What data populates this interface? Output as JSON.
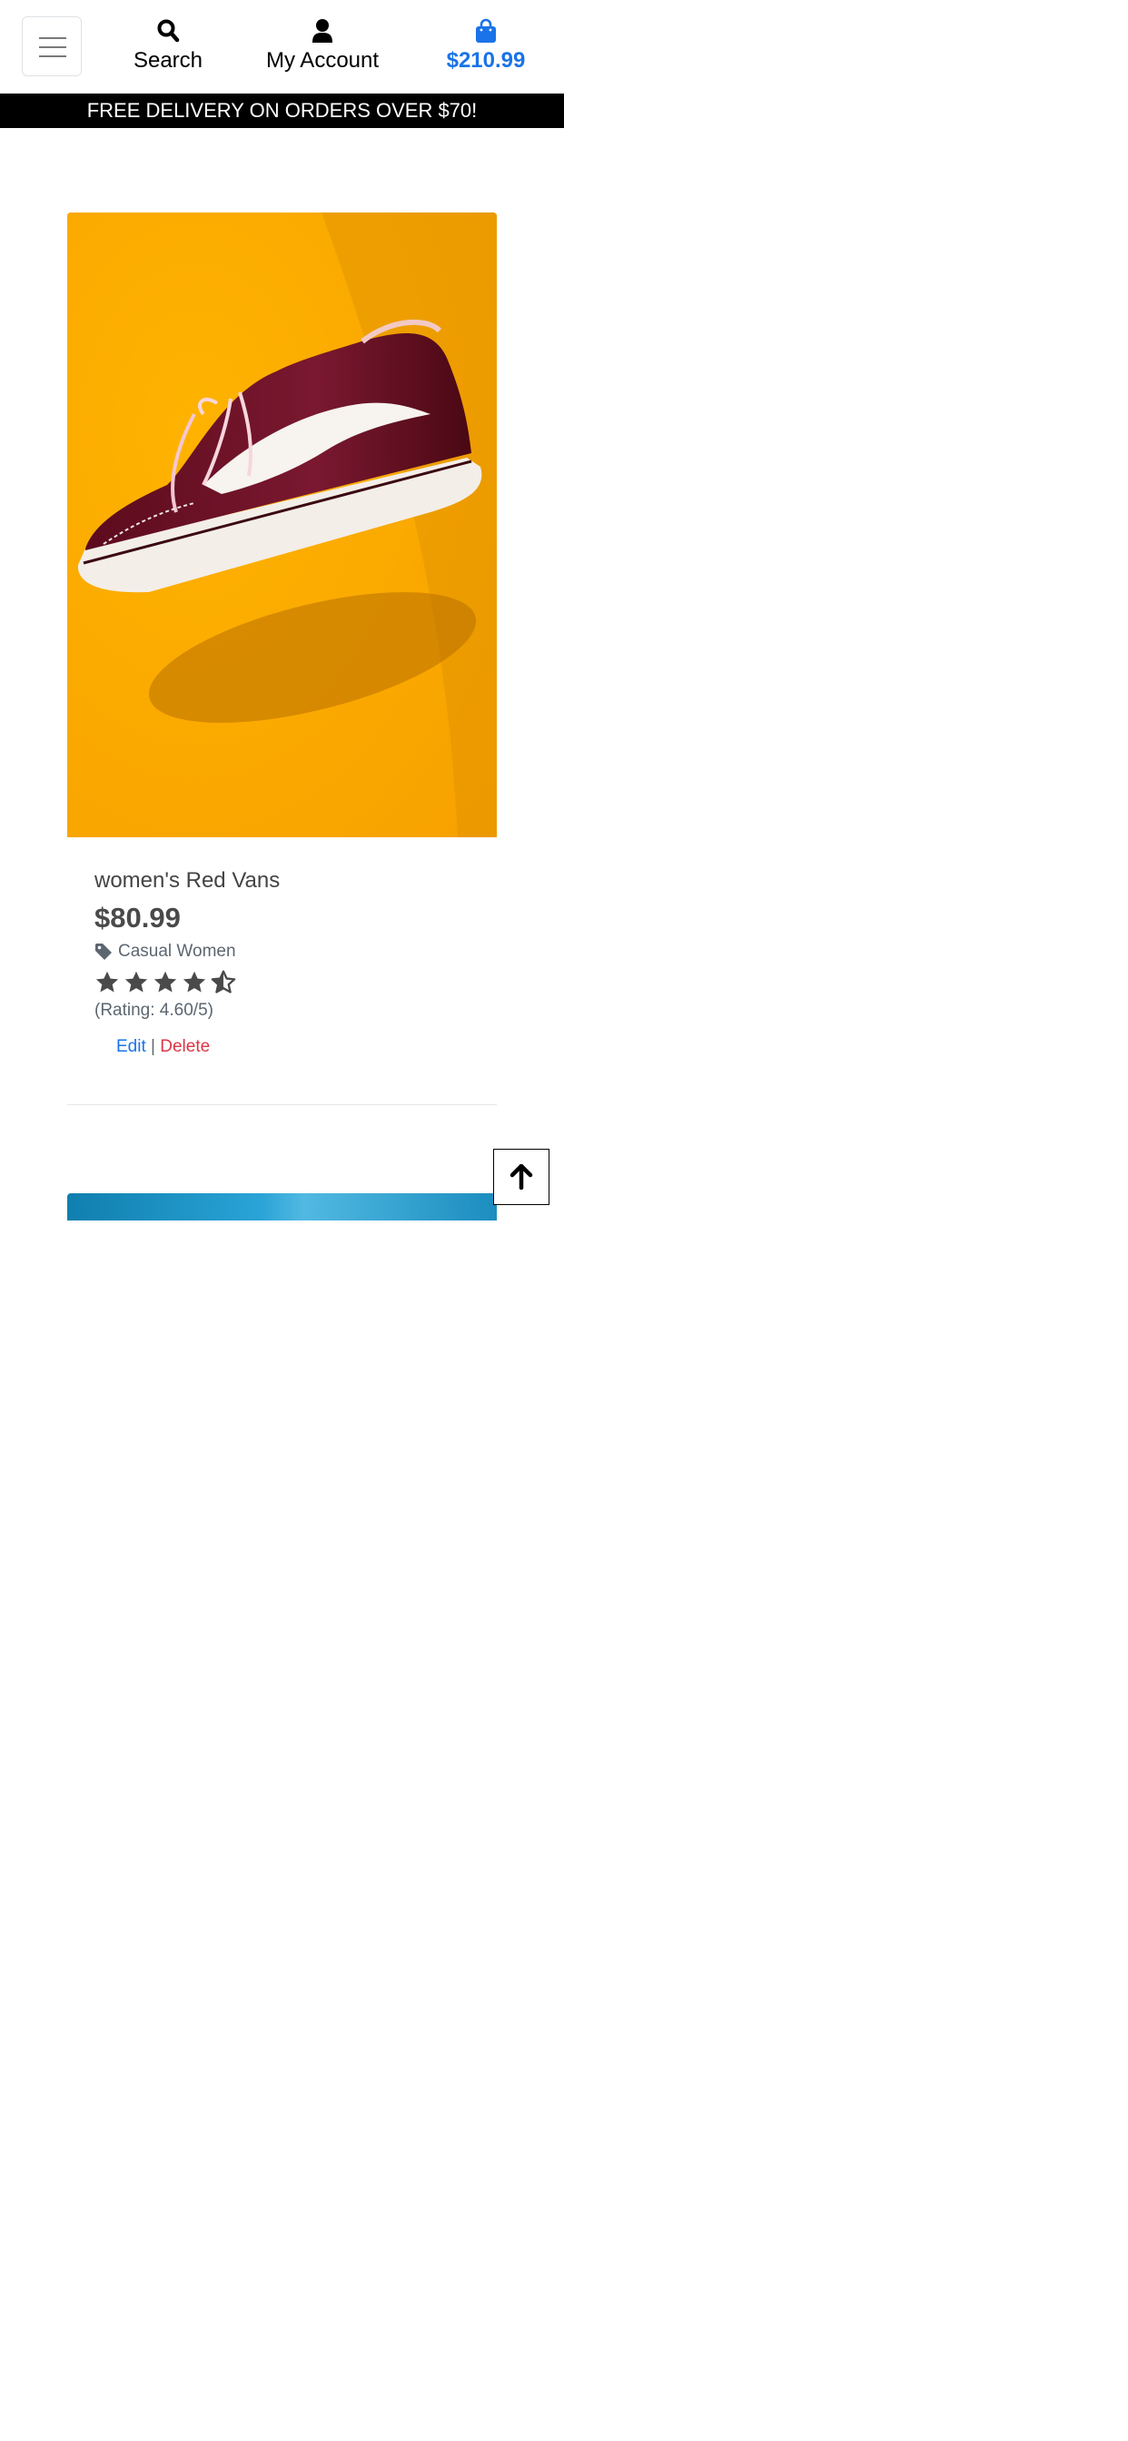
{
  "header": {
    "menu_icon": "hamburger-icon",
    "search": {
      "label": "Search",
      "icon": "search-icon"
    },
    "account": {
      "label": "My Account",
      "icon": "user-icon"
    },
    "bag": {
      "label": "$210.99",
      "icon": "shopping-bag-icon",
      "color": "#1a73e8"
    }
  },
  "banner": {
    "text": "FREE DELIVERY ON ORDERS OVER $70!"
  },
  "product": {
    "name": "women's Red Vans",
    "price": "$80.99",
    "category": "Casual Women",
    "category_icon": "tag-icon",
    "rating_value": 4.6,
    "rating_max": 5,
    "rating_text": "(Rating: 4.60/5)",
    "edit_label": "Edit",
    "separator": "|",
    "delete_label": "Delete"
  },
  "back_to_top_icon": "arrow-up-icon",
  "colors": {
    "accent": "#1a73e8",
    "danger": "#dc3545",
    "banner_bg": "#000000",
    "image_bg": "#fdab00"
  }
}
